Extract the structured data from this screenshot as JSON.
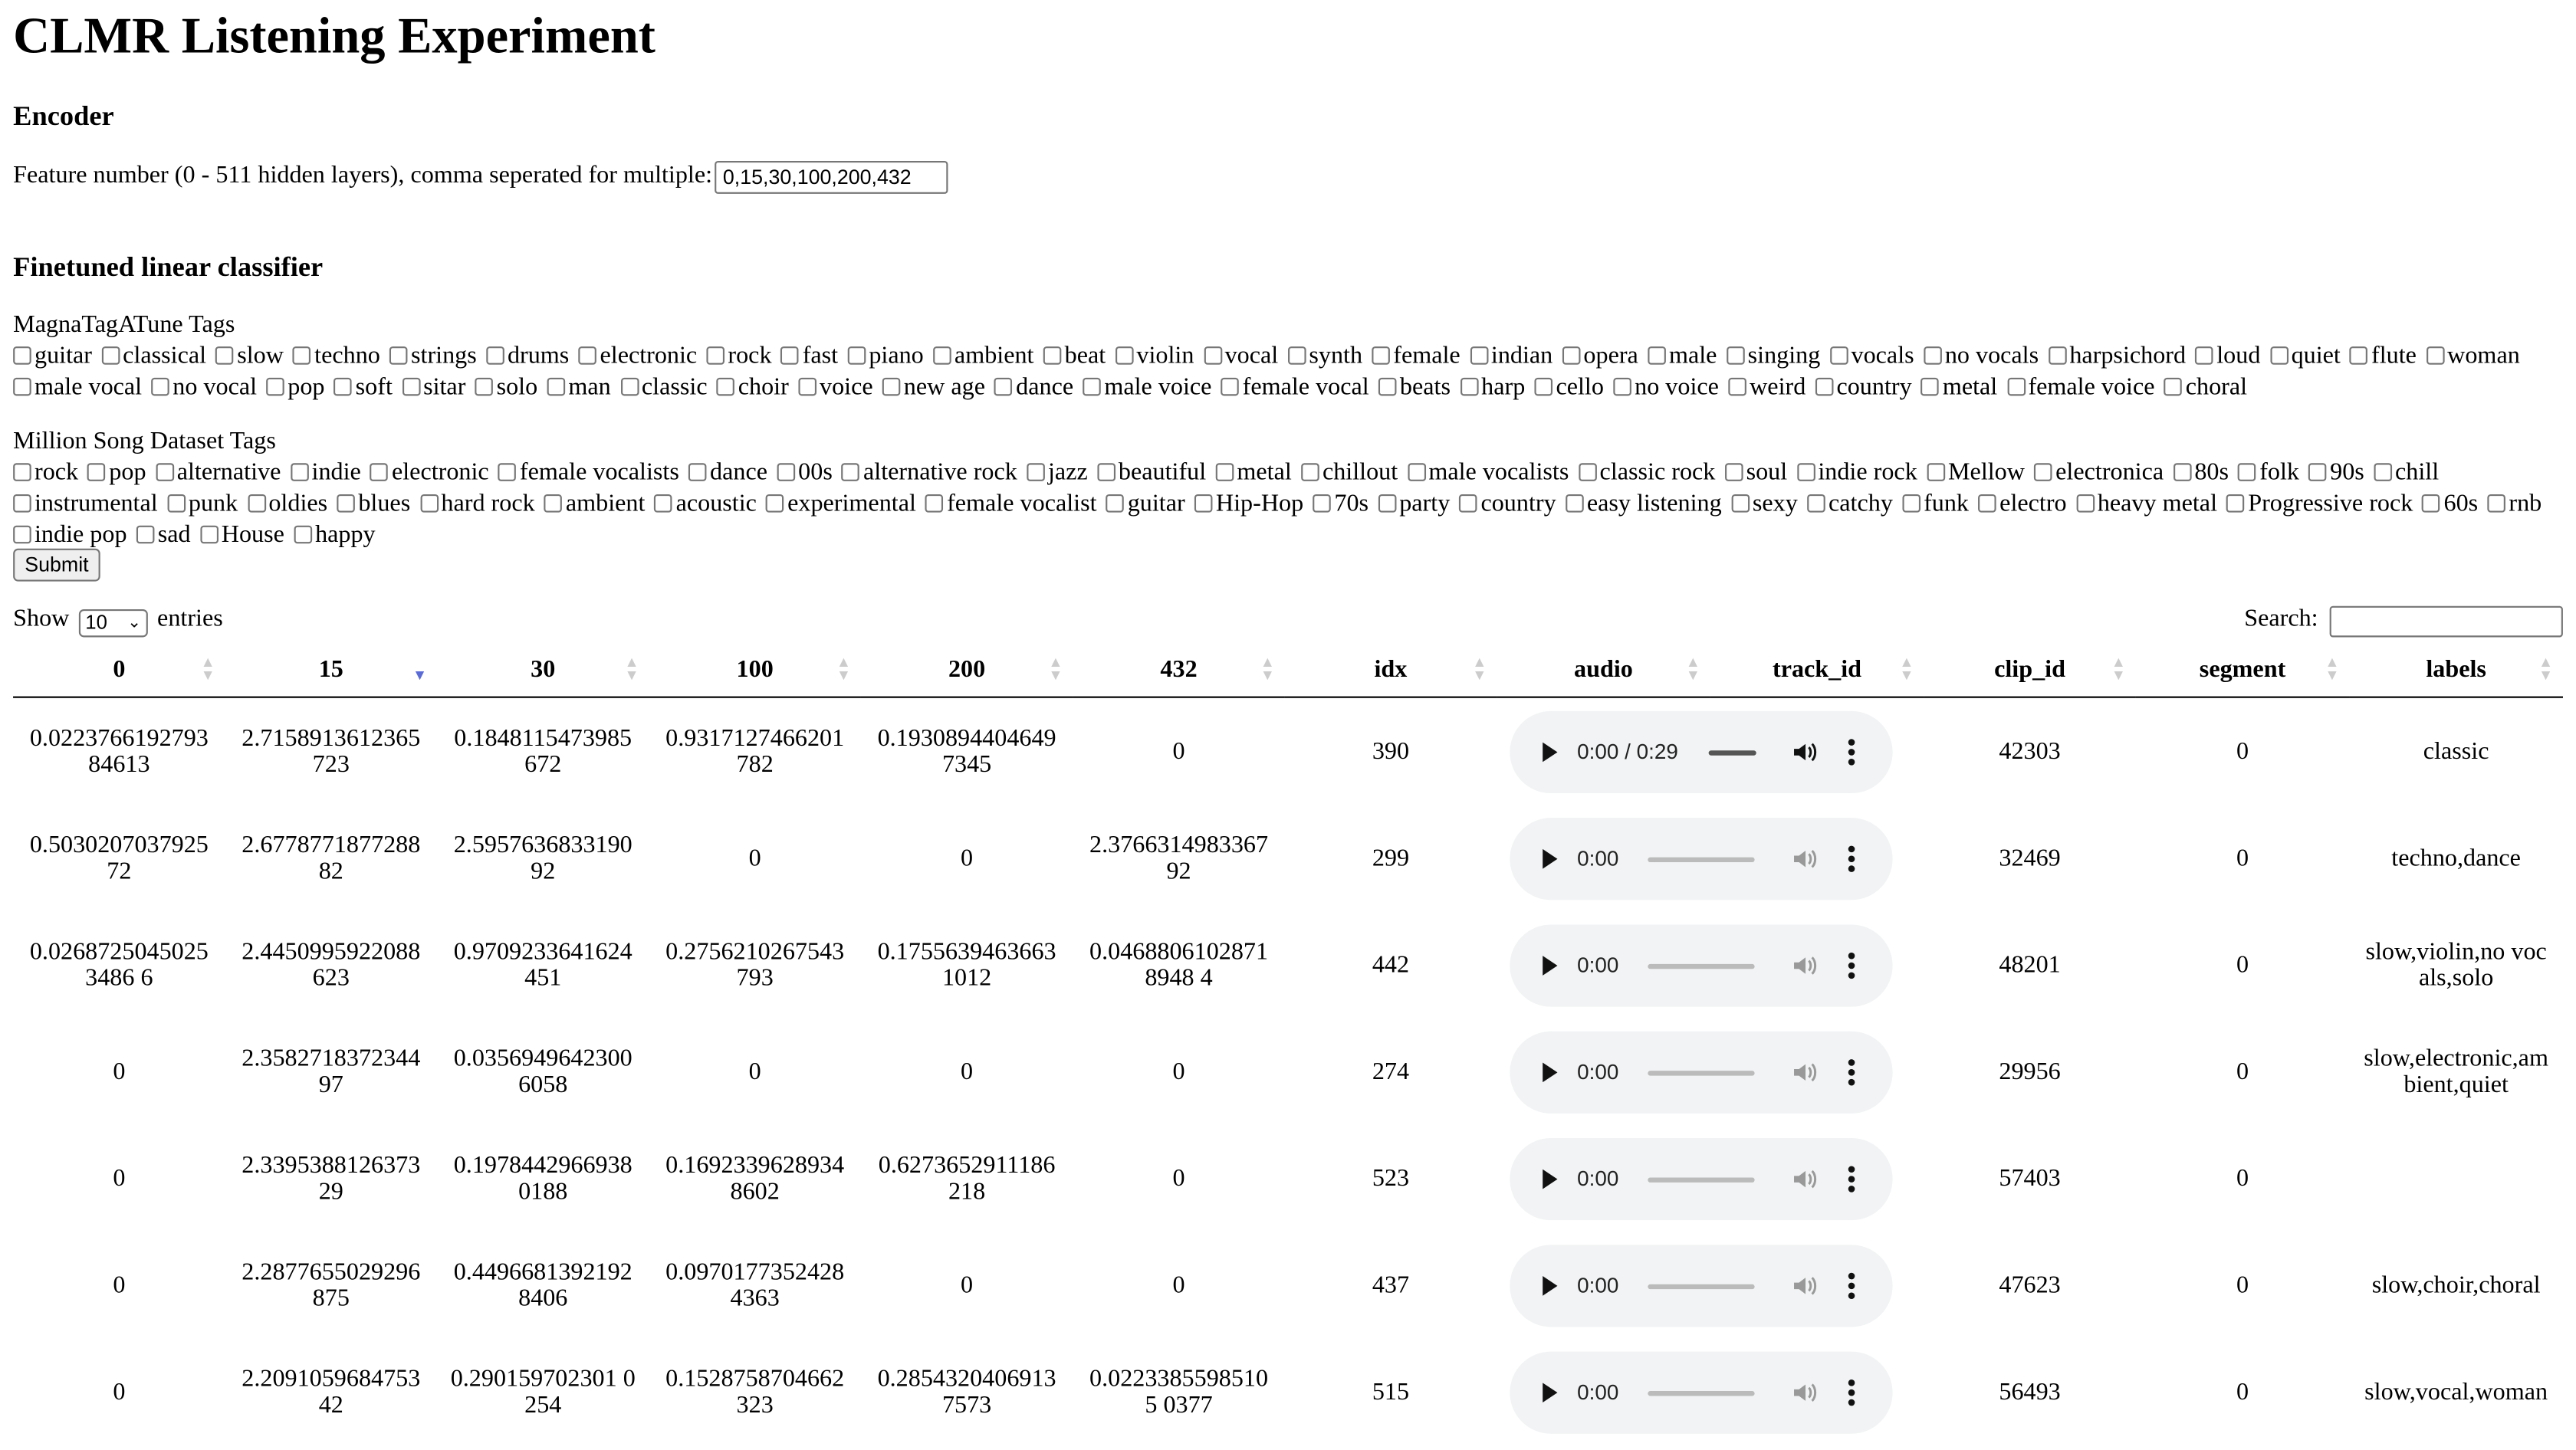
{
  "title": "CLMR Listening Experiment",
  "encoder": {
    "heading": "Encoder",
    "label": "Feature number (0 - 511 hidden layers), comma seperated for multiple:",
    "value": "0,15,30,100,200,432"
  },
  "classifier": {
    "heading": "Finetuned linear classifier",
    "mtat_label": "MagnaTagATune Tags",
    "mtat_tags": [
      "guitar",
      "classical",
      "slow",
      "techno",
      "strings",
      "drums",
      "electronic",
      "rock",
      "fast",
      "piano",
      "ambient",
      "beat",
      "violin",
      "vocal",
      "synth",
      "female",
      "indian",
      "opera",
      "male",
      "singing",
      "vocals",
      "no vocals",
      "harpsichord",
      "loud",
      "quiet",
      "flute",
      "woman",
      "male vocal",
      "no vocal",
      "pop",
      "soft",
      "sitar",
      "solo",
      "man",
      "classic",
      "choir",
      "voice",
      "new age",
      "dance",
      "male voice",
      "female vocal",
      "beats",
      "harp",
      "cello",
      "no voice",
      "weird",
      "country",
      "metal",
      "female voice",
      "choral"
    ],
    "msd_label": "Million Song Dataset Tags",
    "msd_tags": [
      "rock",
      "pop",
      "alternative",
      "indie",
      "electronic",
      "female vocalists",
      "dance",
      "00s",
      "alternative rock",
      "jazz",
      "beautiful",
      "metal",
      "chillout",
      "male vocalists",
      "classic rock",
      "soul",
      "indie rock",
      "Mellow",
      "electronica",
      "80s",
      "folk",
      "90s",
      "chill",
      "instrumental",
      "punk",
      "oldies",
      "blues",
      "hard rock",
      "ambient",
      "acoustic",
      "experimental",
      "female vocalist",
      "guitar",
      "Hip-Hop",
      "70s",
      "party",
      "country",
      "easy listening",
      "sexy",
      "catchy",
      "funk",
      "electro",
      "heavy metal",
      "Progressive rock",
      "60s",
      "rnb",
      "indie pop",
      "sad",
      "House",
      "happy"
    ],
    "submit_label": "Submit"
  },
  "table_controls": {
    "show_label": "Show",
    "entries_value": "10",
    "entries_label": "entries",
    "search_label": "Search:"
  },
  "table": {
    "columns": [
      "0",
      "15",
      "30",
      "100",
      "200",
      "432",
      "idx",
      "audio",
      "track_id",
      "clip_id",
      "segment",
      "labels"
    ],
    "sorted_column": "15",
    "rows": [
      {
        "c0": "0.022376619279384613",
        "c15": "2.7158913612365723",
        "c30": "0.1848115473985672",
        "c100": "0.9317127466201782",
        "c200": "0.19308944046497345",
        "c432": "0",
        "idx": "390",
        "audio_time": "0:00 / 0:29",
        "track_id": "",
        "clip_id": "42303",
        "segment": "0",
        "labels": "classic"
      },
      {
        "c0": "0.503020703792572",
        "c15": "2.677877187728882",
        "c30": "2.595763683319092",
        "c100": "0",
        "c200": "0",
        "c432": "2.376631498336792",
        "idx": "299",
        "audio_time": "0:00",
        "track_id": "",
        "clip_id": "32469",
        "segment": "0",
        "labels": "techno,dance"
      },
      {
        "c0": "0.02687250450253486 6",
        "c15": "2.4450995922088623",
        "c30": "0.9709233641624451",
        "c100": "0.2756210267543793",
        "c200": "0.17556394636631012",
        "c432": "0.04688061028718948 4",
        "idx": "442",
        "audio_time": "0:00",
        "track_id": "",
        "clip_id": "48201",
        "segment": "0",
        "labels": "slow,violin,no vocals,solo"
      },
      {
        "c0": "0",
        "c15": "2.358271837234497",
        "c30": "0.0356949642300 6058",
        "c100": "0",
        "c200": "0",
        "c432": "0",
        "idx": "274",
        "audio_time": "0:00",
        "track_id": "",
        "clip_id": "29956",
        "segment": "0",
        "labels": "slow,electronic,ambient,quiet"
      },
      {
        "c0": "0",
        "c15": "2.339538812637329",
        "c30": "0.1978442966938 0188",
        "c100": "0.1692339628934 8602",
        "c200": "0.6273652911186218",
        "c432": "0",
        "idx": "523",
        "audio_time": "0:00",
        "track_id": "",
        "clip_id": "57403",
        "segment": "0",
        "labels": ""
      },
      {
        "c0": "0",
        "c15": "2.2877655029296875",
        "c30": "0.4496681392192 8406",
        "c100": "0.0970177352428 4363",
        "c200": "0",
        "c432": "0",
        "idx": "437",
        "audio_time": "0:00",
        "track_id": "",
        "clip_id": "47623",
        "segment": "0",
        "labels": "slow,choir,choral"
      },
      {
        "c0": "0",
        "c15": "2.209105968475342",
        "c30": "0.290159702301 0254",
        "c100": "0.1528758704662323",
        "c200": "0.2854320406913 7573",
        "c432": "0.02233855985105 0377",
        "idx": "515",
        "audio_time": "0:00",
        "track_id": "",
        "clip_id": "56493",
        "segment": "0",
        "labels": "slow,vocal,woman"
      }
    ]
  }
}
